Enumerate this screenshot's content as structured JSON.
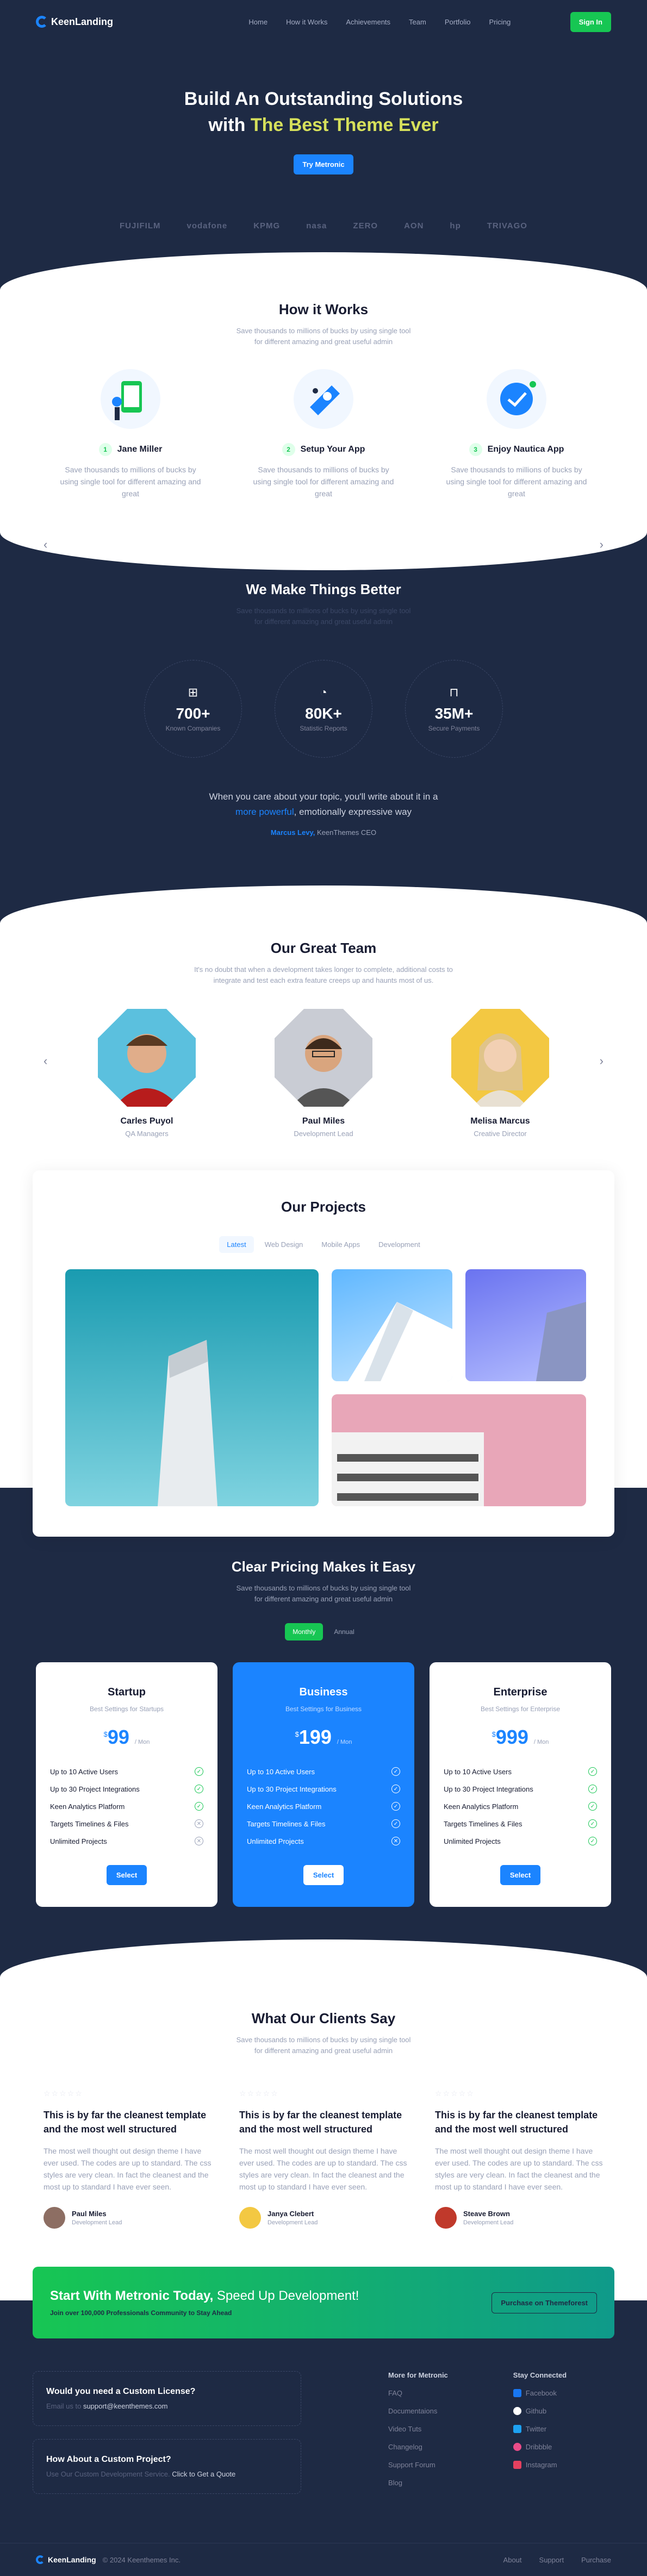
{
  "nav": {
    "brand": "KeenLanding",
    "items": [
      "Home",
      "How it Works",
      "Achievements",
      "Team",
      "Portfolio",
      "Pricing"
    ],
    "signin": "Sign In"
  },
  "hero": {
    "line1": "Build An Outstanding Solutions",
    "line2a": "with",
    "line2b": "The Best Theme Ever",
    "cta": "Try Metronic",
    "logos": [
      "FUJIFILM",
      "vodafone",
      "KPMG",
      "nasa",
      "ZERO",
      "AON",
      "hp",
      "TRIVAGO"
    ]
  },
  "how": {
    "title": "How it Works",
    "subtitle1": "Save thousands to millions of bucks by using single tool",
    "subtitle2": "for different amazing and great useful admin",
    "steps": [
      {
        "num": "1",
        "label": "Jane Miller",
        "text": "Save thousands to millions of bucks by using single tool for different amazing and great"
      },
      {
        "num": "2",
        "label": "Setup Your App",
        "text": "Save thousands to millions of bucks by using single tool for different amazing and great"
      },
      {
        "num": "3",
        "label": "Enjoy Nautica App",
        "text": "Save thousands to millions of bucks by using single tool for different amazing and great"
      }
    ]
  },
  "better": {
    "title": "We Make Things Better",
    "subtitle1": "Save thousands to millions of bucks by using single tool",
    "subtitle2": "for different amazing and great useful admin",
    "stats": [
      {
        "value": "700+",
        "label": "Known Companies",
        "icon": "grid-icon"
      },
      {
        "value": "80K+",
        "label": "Statistic Reports",
        "icon": "chart-pie-icon"
      },
      {
        "value": "35M+",
        "label": "Secure Payments",
        "icon": "basket-icon"
      }
    ],
    "quote_a": "When you care about your topic, you'll write about it in a",
    "quote_hl": "more powerful",
    "quote_b": ", emotionally expressive way",
    "author": "Marcus Levy,",
    "author_role": "KeenThemes CEO"
  },
  "team": {
    "title": "Our Great Team",
    "subtitle1": "It's no doubt that when a development takes longer to complete, additional costs to",
    "subtitle2": "integrate and test each extra feature creeps up and haunts most of us.",
    "members": [
      {
        "name": "Carles Puyol",
        "role": "QA Managers",
        "bg": "#5bc0de"
      },
      {
        "name": "Paul Miles",
        "role": "Development Lead",
        "bg": "#c9ccd4"
      },
      {
        "name": "Melisa Marcus",
        "role": "Creative Director",
        "bg": "#f3c842"
      }
    ]
  },
  "projects": {
    "title": "Our Projects",
    "tabs": [
      "Latest",
      "Web Design",
      "Mobile Apps",
      "Development"
    ]
  },
  "pricing": {
    "title": "Clear Pricing Makes it Easy",
    "subtitle1": "Save thousands to millions of bucks by using single tool",
    "subtitle2": "for different amazing and great useful admin",
    "toggle": [
      "Monthly",
      "Annual"
    ],
    "plans": [
      {
        "name": "Startup",
        "sub": "Best Settings for Startups",
        "currency": "$",
        "price": "99",
        "per": "/ Mon",
        "select": "Select"
      },
      {
        "name": "Business",
        "sub": "Best Settings for Business",
        "currency": "$",
        "price": "199",
        "per": "/ Mon",
        "select": "Select"
      },
      {
        "name": "Enterprise",
        "sub": "Best Settings for Enterprise",
        "currency": "$",
        "price": "999",
        "per": "/ Mon",
        "select": "Select"
      }
    ],
    "features": [
      "Up to 10 Active Users",
      "Up to 30 Project Integrations",
      "Keen Analytics Platform",
      "Targets Timelines & Files",
      "Unlimited Projects"
    ]
  },
  "clients": {
    "title": "What Our Clients Say",
    "subtitle1": "Save thousands to millions of bucks by using single tool",
    "subtitle2": "for different amazing and great useful admin",
    "cards": [
      {
        "stars": "☆☆☆☆☆",
        "heading": "This is by far the cleanest template and the most well structured",
        "text": "The most well thought out design theme I have ever used. The codes are up to standard. The css styles are very clean. In fact the cleanest and the most up to standard I have ever seen.",
        "name": "Paul Miles",
        "role": "Development Lead",
        "av": "#8d6e63"
      },
      {
        "stars": "☆☆☆☆☆",
        "heading": "This is by far the cleanest template and the most well structured",
        "text": "The most well thought out design theme I have ever used. The codes are up to standard. The css styles are very clean. In fact the cleanest and the most up to standard I have ever seen.",
        "name": "Janya Clebert",
        "role": "Development Lead",
        "av": "#f3c842"
      },
      {
        "stars": "☆☆☆☆☆",
        "heading": "This is by far the cleanest template and the most well structured",
        "text": "The most well thought out design theme I have ever used. The codes are up to standard. The css styles are very clean. In fact the cleanest and the most up to standard I have ever seen.",
        "name": "Steave Brown",
        "role": "Development Lead",
        "av": "#c0392b"
      }
    ]
  },
  "cta": {
    "title_b": "Start With Metronic Today,",
    "title_n": "Speed Up Development!",
    "sub": "Join over 100,000 Professionals Community to Stay Ahead",
    "button": "Purchase on Themeforest"
  },
  "footer": {
    "q1": "Would you need a Custom License?",
    "q1_pre": "Email us to",
    "q1_link": "support@keenthemes.com",
    "q2": "How About a Custom Project?",
    "q2_pre": "Use Our Custom Development Service.",
    "q2_link": "Click to Get a Quote",
    "col1_title": "More for Metronic",
    "col1": [
      "FAQ",
      "Documentaions",
      "Video Tuts",
      "Changelog",
      "Support Forum",
      "Blog"
    ],
    "col2_title": "Stay Connected",
    "col2": [
      {
        "label": "Facebook",
        "color": "#1877f2"
      },
      {
        "label": "Github",
        "color": "#ffffff"
      },
      {
        "label": "Twitter",
        "color": "#1da1f2"
      },
      {
        "label": "Dribbble",
        "color": "#ea4c89"
      },
      {
        "label": "Instagram",
        "color": "#e4405f"
      }
    ],
    "brand": "KeenLanding",
    "copyright": "© 2024 Keenthemes Inc.",
    "links": [
      "About",
      "Support",
      "Purchase"
    ]
  }
}
